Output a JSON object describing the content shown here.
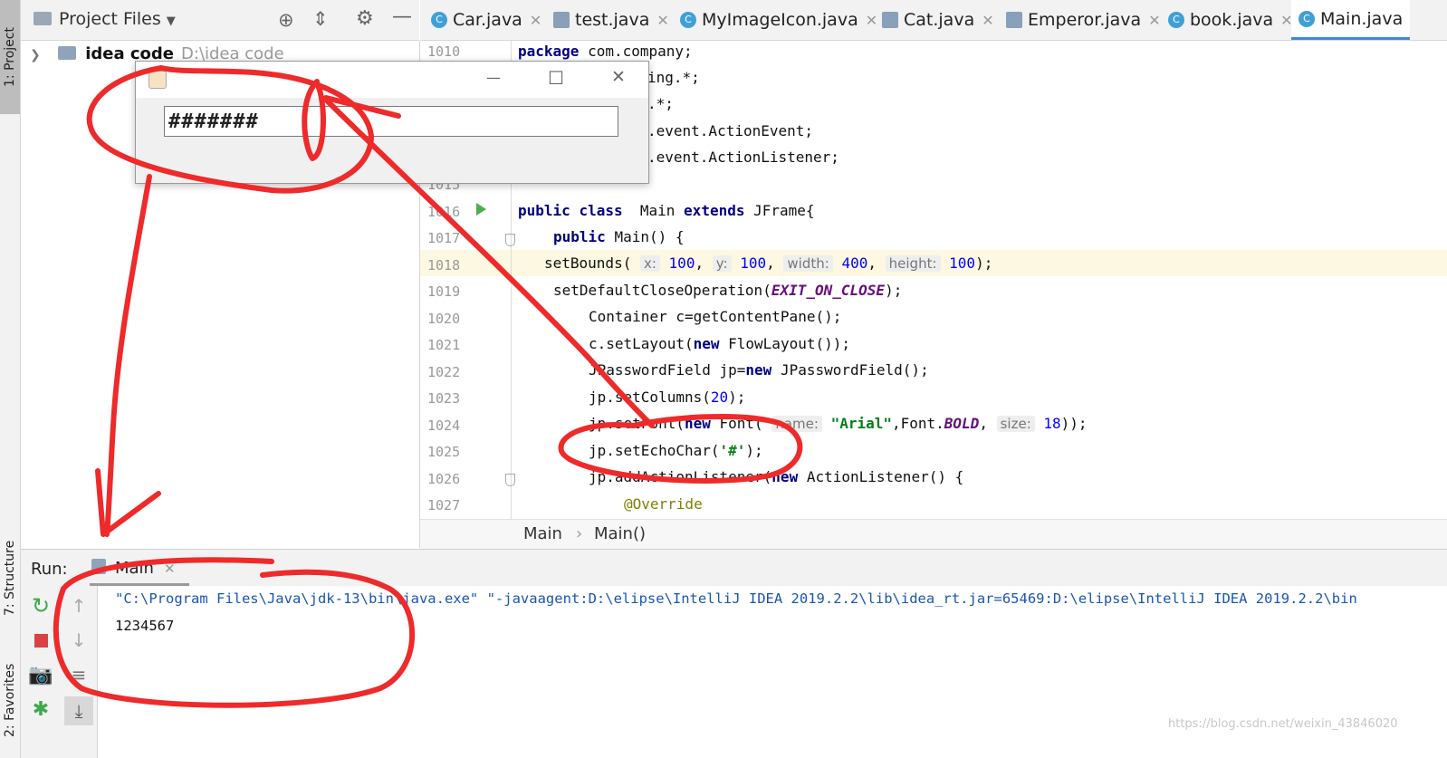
{
  "left_strip": {
    "project_tab": "1: Project",
    "structure_tab": "7: Structure",
    "favorites_tab": "2: Favorites"
  },
  "project_panel": {
    "title": "Project Files",
    "tree": [
      {
        "name": "idea code",
        "path": "D:\\idea code"
      }
    ]
  },
  "tabs": [
    {
      "label": "Car.java",
      "icon": "class-icon"
    },
    {
      "label": "test.java",
      "icon": "file-icon"
    },
    {
      "label": "MyImageIcon.java",
      "icon": "class-icon"
    },
    {
      "label": "Cat.java",
      "icon": "file-icon"
    },
    {
      "label": "Emperor.java",
      "icon": "file-icon"
    },
    {
      "label": "book.java",
      "icon": "class-icon"
    },
    {
      "label": "Main.java",
      "icon": "class-icon",
      "active": true
    }
  ],
  "code": {
    "line_numbers": [
      "1010",
      "",
      "",
      "",
      "",
      "1015",
      "1016",
      "1017",
      "1018",
      "1019",
      "1020",
      "1021",
      "1022",
      "1023",
      "1024",
      "1025",
      "1026",
      "1027"
    ],
    "l1010": [
      "package",
      "com.company;"
    ],
    "l_import1": "ing.*;",
    "l_import2": ".*;",
    "l_import3": ".event.ActionEvent;",
    "l_import4": ".event.ActionListener;",
    "l1016": [
      "public",
      "class",
      "Main",
      "extends",
      "JFrame{"
    ],
    "l1017": [
      "public",
      "Main() {"
    ],
    "l1018": [
      "setBounds(",
      "x:",
      "100",
      ",",
      "y:",
      "100",
      ",",
      "width:",
      "400",
      ",",
      "height:",
      "100",
      ");"
    ],
    "l1019": [
      "setDefaultCloseOperation(",
      "EXIT_ON_CLOSE",
      ");"
    ],
    "l1020": "Container c=getContentPane();",
    "l1021": [
      "c.setLayout(",
      "new",
      "FlowLayout());"
    ],
    "l1022": [
      "JPasswordField jp=",
      "new",
      "JPasswordField();"
    ],
    "l1023": [
      "jp.setColumns(",
      "20",
      ");"
    ],
    "l1024": [
      "jp.setFont(",
      "new",
      "Font(",
      "name:",
      "\"Arial\"",
      ",Font.",
      "BOLD",
      ",",
      "size:",
      "18",
      "));"
    ],
    "l1025": [
      "jp.setEchoChar(",
      "'#'",
      ");"
    ],
    "l1026": [
      "jp.addActionListener(",
      "new",
      "ActionListener() {"
    ],
    "l1027": "@Override"
  },
  "breadcrumb": {
    "class": "Main",
    "separator": "›",
    "method": "Main()"
  },
  "run": {
    "label": "Run:",
    "tab": "Main",
    "console_lines": [
      "\"C:\\Program Files\\Java\\jdk-13\\bin\\java.exe\" \"-javaagent:D:\\elipse\\IntelliJ IDEA 2019.2.2\\lib\\idea_rt.jar=65469:D:\\elipse\\IntelliJ IDEA 2019.2.2\\bin",
      "1234567"
    ]
  },
  "dialog": {
    "password_echo": "#######",
    "controls": {
      "minimize": "—",
      "maximize": "☐",
      "close": "✕"
    }
  },
  "watermark": "https://blog.csdn.net/weixin_43846020",
  "colors": {
    "accent": "#3f8ad6",
    "annotation_red": "#ee2a2a",
    "keyword": "#000080",
    "number": "#0000ff",
    "string": "#067d17"
  }
}
